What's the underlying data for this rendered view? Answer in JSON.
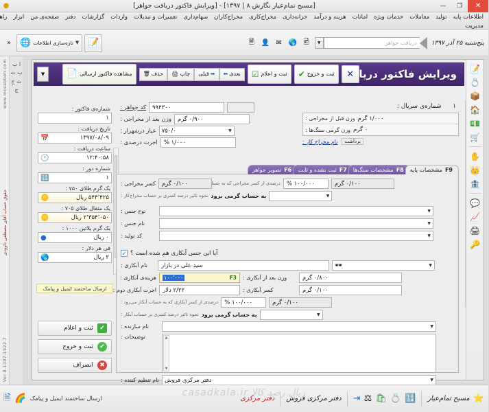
{
  "window": {
    "title": "[مسبح تمام‌عیار نگارش ۸ | ۱۳۹۷] - [ویرایش فاکتور دریافت جواهر]",
    "minimize": "—",
    "maximize": "❐",
    "close": "✕",
    "logo_icon": "app-logo-icon"
  },
  "menubar": {
    "items": [
      "اطلاعات پایه",
      "تولید",
      "معاملات",
      "خدمات ویژه",
      "امانات",
      "هزینه و درآمد",
      "خزانه‌داری",
      "مخراج‌کاری",
      "مخراج‌کاران",
      "سهام‌داری",
      "تعمیرات و تبدیلات",
      "واردات",
      "گزارشات",
      "دفتر",
      "صفحه‌ی من",
      "ابزار",
      "راهنما"
    ],
    "second_row": "مدیریت"
  },
  "toolbar": {
    "date": "پنج‌شنبه ۲۵ آذر ۱۳۹۷",
    "search_placeholder": "دریافت جواهر",
    "search_value": "",
    "dropdown_icon": "chevron-down-icon",
    "icons": [
      "window-icon",
      "globe-icon",
      "envelope-icon",
      "person-icon",
      "photo-icon"
    ],
    "info_button": "تازه‌سازی اطلاعات",
    "info_icon": "globe-blue-icon",
    "new_button_icon": "new-document-icon",
    "overflow": "«"
  },
  "form": {
    "title": "ویرایش فاکتور دریافت جواهر",
    "header_dropdown_icon": "chevron-down-icon",
    "tools": [
      {
        "label": "مشاهده فاکتور ارسالی",
        "icon": "document-view-icon"
      },
      {
        "label": "حذف",
        "icon": "delete-icon"
      },
      {
        "label": "چاپ",
        "icon": "print-icon"
      },
      {
        "label": "قبلی",
        "icon": "arrow-prev-icon"
      },
      {
        "label": "بعدی",
        "icon": "arrow-next-icon"
      },
      {
        "label": "ثبت و اعلام",
        "icon": "check-square-icon"
      },
      {
        "label": "ثبت و خروج",
        "icon": "check-circle-icon"
      },
      {
        "label": "✕",
        "icon": "close-icon"
      }
    ]
  },
  "info_panel": {
    "invoice_number_label": "شماره‌ی فاکتور :",
    "invoice_number": "۱",
    "receive_date_label": "تاریخ دریافت :",
    "receive_date": "۱۳۹۷/۰۸/۰۹",
    "receive_date_icon": "calendar-icon",
    "receive_time_label": "ساعت دریافت :",
    "receive_time": "۱۲:۴۰:۵۸",
    "receive_time_icon": "clock-icon",
    "round_number_label": "شماره دور :",
    "round_number": "۱",
    "round_icon": "counter-icon",
    "gold750_label": "یک گرم طلای ۷۵۰ :",
    "gold750_value": "۵۴۳٬۴۲۵ ریال",
    "gold750_icon": "gold-coin-icon",
    "mithqal705_label": "یک مثقال طلای ۷۰۵ :",
    "mithqal705_value": "۲٬۳۵۴٬۰۵۰ ریال",
    "mithqal705_icon": "gold-coin-icon",
    "platinum_label": "یک گرم پلاتین ۱۰۰۰ :",
    "platinum_value": "۰ ریال",
    "platinum_icon": "platinum-icon",
    "dollar_label": "فی هر دلار :",
    "dollar_value": "۲ ریال",
    "dollar_icon": "globe-green-icon",
    "send_mail_sms": "ارسال ساختمند ایمیل و پیامک"
  },
  "actions": [
    {
      "label": "ثبت و اعلام",
      "icon": "check-square-icon",
      "color": "#3fae3f"
    },
    {
      "label": "ثبت و خروج",
      "icon": "check-circle-icon",
      "color": "#4fbb4f"
    },
    {
      "label": "انصراف",
      "icon": "cancel-icon",
      "color": "#d8453c"
    }
  ],
  "top_fields": {
    "serial_label": "شماره‌ی سریال :",
    "serial_value": "۱",
    "weight_before_label": "وزن قبل از مخراجی :",
    "weight_before_value": "۱/۰۰۰ گرم",
    "stones_weight_label": "وزن گرمی سنگ‌ها :",
    "stones_weight_value": "۰ گرم",
    "setter_name_label": "نام مخراج کار :",
    "setter_name_value": "برداشت",
    "jewel_code_label": "کد جواهر :",
    "jewel_code_value": "۹۹۴۳۰۰",
    "weight_after_label": "وزن بعد از مخراجی :",
    "weight_after_value": "۰/۹۰۰ گرم",
    "carat_label": "عیار درشهرار :",
    "carat_value": "۷۵۰/۰",
    "wage_percent_label": "اجرت درصدی :",
    "wage_percent_value": "۱/۰۰۰ %"
  },
  "tabs": [
    {
      "label": "مشخصات پایه",
      "key": "F9",
      "active": true
    },
    {
      "label": "مشخصات سنگ‌ها",
      "key": "F8",
      "active": false
    },
    {
      "label": "ثبت نشده و ثابت",
      "key": "F7",
      "active": false
    },
    {
      "label": "تصویر جواهر",
      "key": "F6",
      "active": false
    }
  ],
  "panel": {
    "deduction_label": "کسر مخراجی :",
    "deduction_value": "۰/۱۰۰ گرم",
    "deduction_note": "درصدی از کسر مخراجی که به حساب مخراج‌کار می‌رود :",
    "deduction_percent": "۱۰۰/۰۰۰ %",
    "deduction_gram": "۰/۱۰۰ گرم",
    "deduction_effect_note": "نحوه تاثیر درصد کسری بر حساب مخراج‌کار :",
    "deduction_effect_value": "به حساب گرمی برود",
    "item_type_label": "نوع جنس :",
    "item_type_value": "",
    "item_tag_label": "نام جنس :",
    "item_tag_value": "",
    "item_code_label": "کد تولید :",
    "item_code_value": "",
    "plating_question": "آیا این جنس آبکاری هم شده است ؟",
    "plating_checked": "✓",
    "plating_name_label": "نام آبکاری :",
    "plating_name_value": "سید علی در بازار",
    "plating_search_icon": "binoculars-icon",
    "plating_cost_label": "هزینه‌ی آبکاری :",
    "plating_cost_value": "۱۰۰٬۰۰۰",
    "plating_cost_fkey": "F3",
    "plating_weight_after_label": "وزن بعد از آبکاری :",
    "plating_weight_after_value": "۰/۸۰۰ گرم",
    "plating_wage2_label": "اجرت آبکاری دوم :",
    "plating_wage2_value": "۲/۲۲ دلار",
    "plating_deduction_label": "کسر آبکاری :",
    "plating_deduction_value": "۰/۱۰۰ گرم",
    "plating_percent_note": "درصدی از کسر آبکاری که به حساب آبکار می‌رود :",
    "plating_percent_value": "۱۰۰/۰۰۰ %",
    "plating_percent_gram": "۰/۱۰۰ گرم",
    "plating_effect_note": "نحوه تاثیر درصد کسری بر حساب آبکار :",
    "plating_effect_value": "به حساب گرمی برود",
    "maker_label": "نام سازنده :",
    "maker_value": "",
    "description_label": "توضیحات :",
    "description_value": "",
    "registrar_label": "نام تنظیم کننده :",
    "registrar_value": "دفتر مرکزی فروش"
  },
  "side_strip": {
    "site": "www.mosabbeh.com",
    "owner": "حقوق حساب آقای مصطفی داوودی",
    "version": "Ver 8.1397.1922.7",
    "letters": "ا ب پ ت ث ج چ"
  },
  "statusbar": {
    "brand": "مسبح تمام‌عیار",
    "star_icon": "star-icon",
    "icons": [
      "calculator-icon",
      "ring-icon",
      "bag-icon",
      "scale-icon",
      "exit-icon"
    ],
    "office_sell": "دفتر مرکزی فروش",
    "office_main": "دفتر مرکزی",
    "watermark": "ریال رصد کالا   casadkala.ir",
    "mail_sms": "ارسال ساختمند ایمیل و پیامک",
    "left_icons": [
      "colors-icon",
      "window-blue-icon"
    ]
  }
}
